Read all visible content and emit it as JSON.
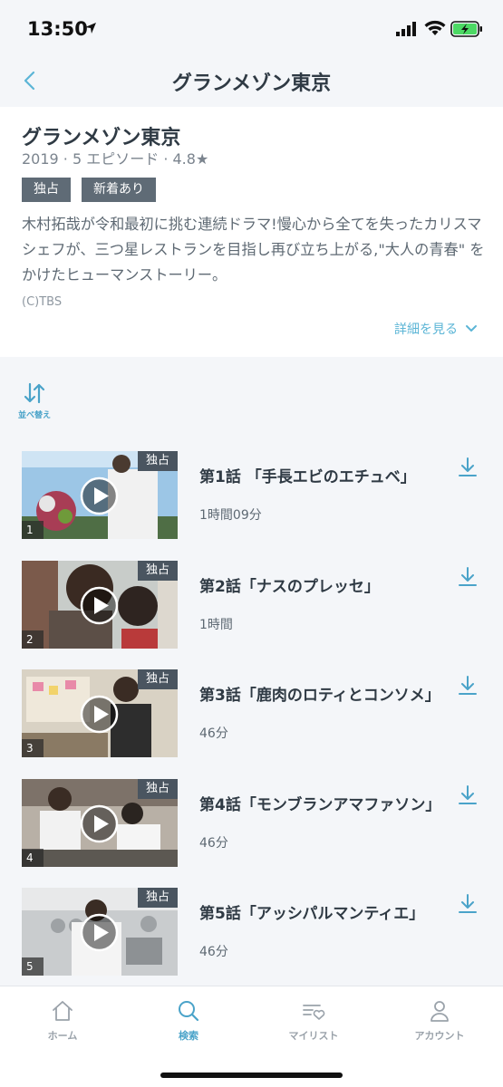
{
  "status_bar": {
    "time": "13:50"
  },
  "nav": {
    "title": "グランメゾン東京"
  },
  "show": {
    "title": "グランメゾン東京",
    "meta": "2019 · 5 エピソード · 4.8★",
    "badges": [
      "独占",
      "新着あり"
    ],
    "description": "木村拓哉が令和最初に挑む連続ドラマ!慢心から全てを失ったカリスマシェフが、三つ星レストランを目指し再び立ち上がる,\"大人の青春\" をかけたヒューマンストーリー。",
    "copyright": "(C)TBS",
    "details_link": "詳細を見る"
  },
  "sort": {
    "label": "並べ替え"
  },
  "episodes": [
    {
      "number": "1",
      "badge": "独占",
      "title": "第1話 「手長エビのエチュベ」",
      "duration": "1時間09分"
    },
    {
      "number": "2",
      "badge": "独占",
      "title": "第2話「ナスのプレッセ」",
      "duration": "1時間"
    },
    {
      "number": "3",
      "badge": "独占",
      "title": "第3話「鹿肉のロティとコンソメ」",
      "duration": "46分"
    },
    {
      "number": "4",
      "badge": "独占",
      "title": "第4話「モンブランアマファソン」",
      "duration": "46分"
    },
    {
      "number": "5",
      "badge": "独占",
      "title": "第5話「アッシパルマンティエ」",
      "duration": "46分"
    }
  ],
  "tabs": [
    {
      "label": "ホーム",
      "icon": "home-icon"
    },
    {
      "label": "検索",
      "icon": "search-icon"
    },
    {
      "label": "マイリスト",
      "icon": "mylist-icon"
    },
    {
      "label": "アカウント",
      "icon": "account-icon"
    }
  ],
  "colors": {
    "accent": "#4aa3c9",
    "badge": "#5f6b76",
    "background": "#f4f6f9"
  }
}
